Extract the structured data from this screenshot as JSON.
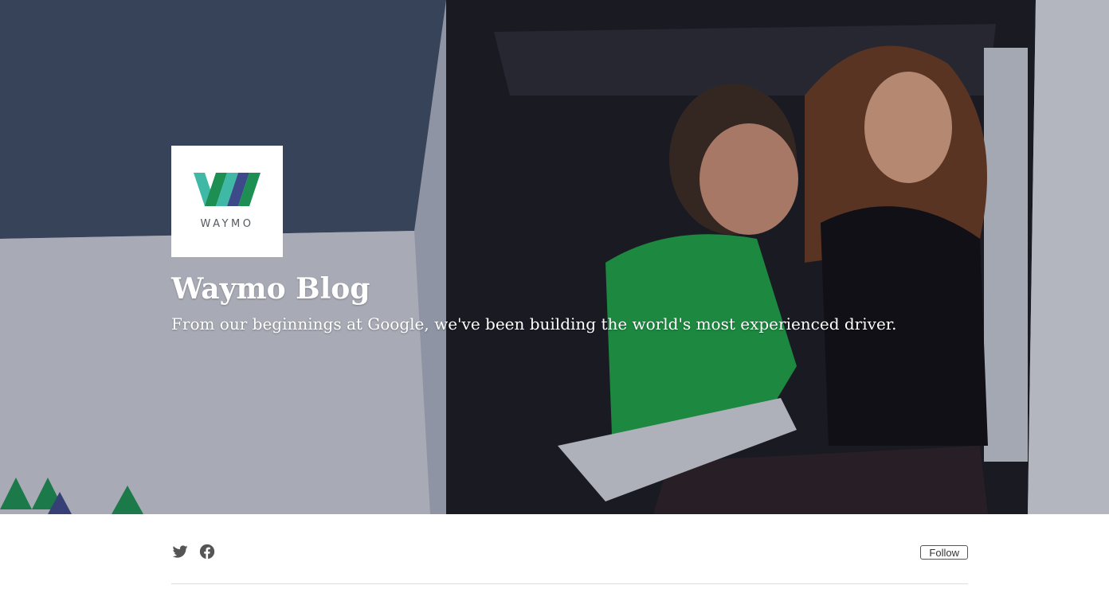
{
  "hero": {
    "logo_wordmark": "WAYMO",
    "logo_icon": "waymo-w-icon",
    "title": "Waymo Blog",
    "subtitle": "From our beginnings at Google, we've been building the world's most experienced driver."
  },
  "social": {
    "twitter_icon": "twitter-icon",
    "facebook_icon": "facebook-icon"
  },
  "follow_label": "Follow",
  "colors": {
    "brand_green": "#1e8f52",
    "brand_teal": "#3fb8a6",
    "brand_navy": "#3d4a8a",
    "icon_gray": "#555555"
  }
}
